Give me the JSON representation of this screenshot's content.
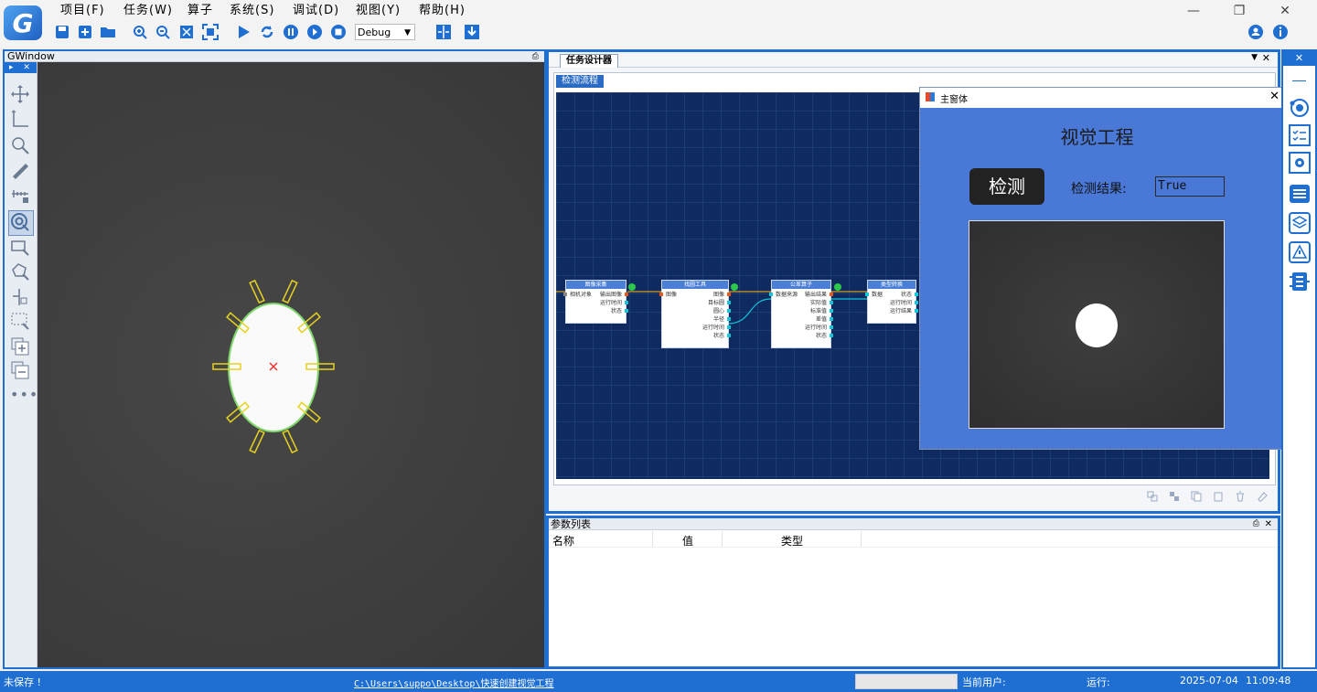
{
  "menu": {
    "items": [
      "项目(F)",
      "任务(W)",
      "算子",
      "系统(S)",
      "调试(D)",
      "视图(Y)",
      "帮助(H)"
    ]
  },
  "toolbar": {
    "mode": "Debug"
  },
  "left_panel": {
    "title": "GWindow"
  },
  "designer": {
    "tab": "任务设计器",
    "subtab": "检测流程"
  },
  "nodes": [
    {
      "title": "图像采集",
      "inputs": [
        "相机对象"
      ],
      "outputs": [
        "输出图像",
        "运行时间",
        "状态"
      ]
    },
    {
      "title": "找圆工具",
      "inputs": [
        "图像"
      ],
      "outputs": [
        "图像",
        "目标圆",
        "圆心",
        "半径",
        "运行时间",
        "状态"
      ]
    },
    {
      "title": "公差算子",
      "inputs": [
        "数据来源"
      ],
      "outputs": [
        "输出结果",
        "实际值",
        "标准值",
        "差值",
        "运行时间",
        "状态"
      ]
    },
    {
      "title": "类型转换",
      "inputs": [
        "数据"
      ],
      "outputs": [
        "状态",
        "运行时间",
        "运行结果"
      ]
    }
  ],
  "main_window": {
    "title": "主窗体",
    "heading": "视觉工程",
    "detect_button": "检测",
    "result_label": "检测结果:",
    "result_value": "True"
  },
  "params": {
    "title": "参数列表",
    "columns": [
      "名称",
      "值",
      "类型"
    ]
  },
  "status": {
    "save_state": "未保存 !",
    "path": "C:\\Users\\suppo\\Desktop\\快速创建视觉工程",
    "user_label": "当前用户:",
    "run_label": "运行:",
    "date": "2025-07-04",
    "time": "11:09:48"
  },
  "colors": {
    "accent": "#1e6fd1",
    "canvas": "#0e2a5e",
    "form": "#4a78d6",
    "status_bar": "#1e6fd1"
  }
}
